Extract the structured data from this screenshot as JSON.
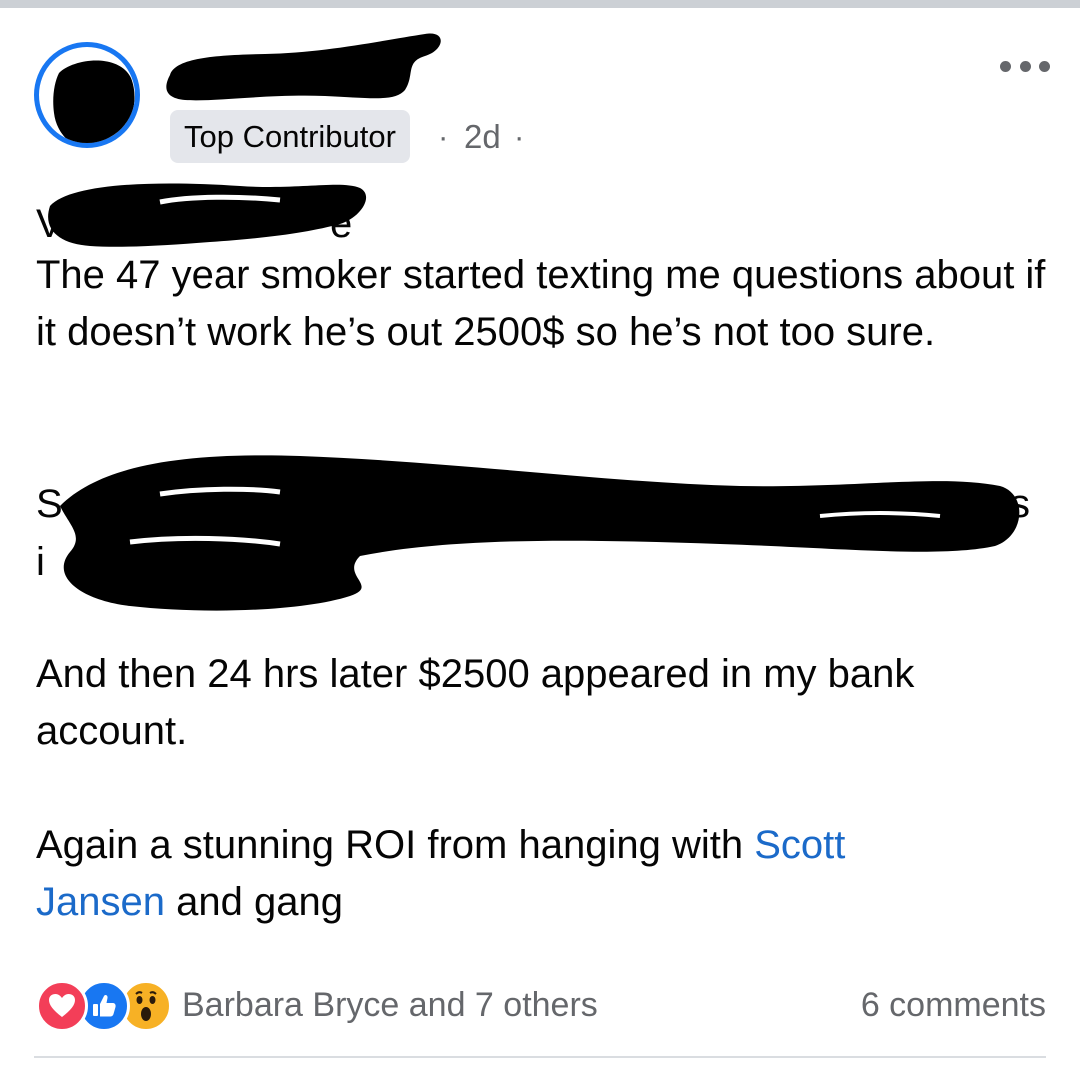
{
  "post": {
    "badge": "Top Contributor",
    "sep1": "·",
    "time": "2d",
    "sep2": "·",
    "stray_a": "V",
    "stray_b": "e",
    "stray_c": "S",
    "stray_d": "ks",
    "stray_e": "i",
    "paragraph1": "The 47 year smoker started texting me questions about if it doesn’t work he’s out 2500$ so he’s not too sure.",
    "paragraph3": "And then 24 hrs later $2500 appeared in my bank account.",
    "paragraph4_before": "Again a stunning ROI from hanging with ",
    "paragraph4_mention_first": "Scott",
    "paragraph4_mention_last": "Jansen",
    "paragraph4_after": " and gang"
  },
  "footer": {
    "reactors": "Barbara Bryce and 7 others",
    "comments": "6 comments",
    "reaction_icons": [
      "heart-icon",
      "like-icon",
      "wow-icon"
    ]
  },
  "colors": {
    "accent": "#1877f2",
    "mention": "#1b6ac9",
    "meta": "#65676b",
    "badge_bg": "#e4e6eb",
    "love": "#f33e58",
    "like": "#1877f2",
    "wow": "#f7b125"
  }
}
